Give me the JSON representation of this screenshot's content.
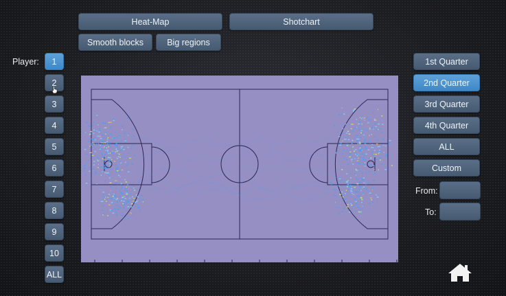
{
  "view_tabs": [
    {
      "label": "Heat-Map",
      "active": true
    },
    {
      "label": "Shotchart",
      "active": false
    }
  ],
  "mode_tabs": [
    {
      "label": "Smooth blocks",
      "active": true
    },
    {
      "label": "Big regions",
      "active": false
    }
  ],
  "player": {
    "label": "Player:",
    "buttons": [
      "1",
      "2",
      "3",
      "4",
      "5",
      "6",
      "7",
      "8",
      "9",
      "10",
      "ALL"
    ],
    "active_index": 0
  },
  "quarters": {
    "buttons": [
      "1st Quarter",
      "2nd Quarter",
      "3rd Quarter",
      "4th Quarter",
      "ALL",
      "Custom"
    ],
    "active_index": 1
  },
  "range": {
    "from_label": "From:",
    "to_label": "To:",
    "from_value": "",
    "to_value": ""
  },
  "court": {
    "background_color": "#958fc4",
    "line_color": "#2a2550",
    "heat_colors": [
      "#3ea0ff",
      "#7fd8ff",
      "#d8f060",
      "#f0c040"
    ]
  },
  "colors": {
    "active": "#4a93d0",
    "inactive": "#50647c"
  },
  "icons": {
    "home": "home-icon",
    "cursor": "hand-cursor-icon"
  }
}
